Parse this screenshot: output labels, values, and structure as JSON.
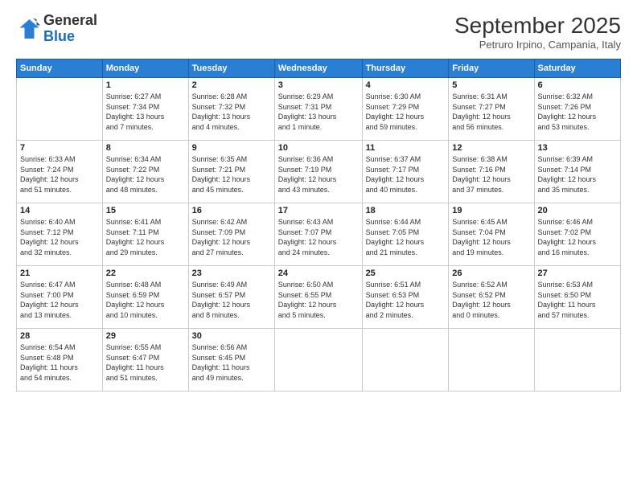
{
  "header": {
    "logo_line1": "General",
    "logo_line2": "Blue",
    "month": "September 2025",
    "location": "Petruro Irpino, Campania, Italy"
  },
  "weekdays": [
    "Sunday",
    "Monday",
    "Tuesday",
    "Wednesday",
    "Thursday",
    "Friday",
    "Saturday"
  ],
  "weeks": [
    [
      {
        "day": "",
        "info": ""
      },
      {
        "day": "1",
        "info": "Sunrise: 6:27 AM\nSunset: 7:34 PM\nDaylight: 13 hours\nand 7 minutes."
      },
      {
        "day": "2",
        "info": "Sunrise: 6:28 AM\nSunset: 7:32 PM\nDaylight: 13 hours\nand 4 minutes."
      },
      {
        "day": "3",
        "info": "Sunrise: 6:29 AM\nSunset: 7:31 PM\nDaylight: 13 hours\nand 1 minute."
      },
      {
        "day": "4",
        "info": "Sunrise: 6:30 AM\nSunset: 7:29 PM\nDaylight: 12 hours\nand 59 minutes."
      },
      {
        "day": "5",
        "info": "Sunrise: 6:31 AM\nSunset: 7:27 PM\nDaylight: 12 hours\nand 56 minutes."
      },
      {
        "day": "6",
        "info": "Sunrise: 6:32 AM\nSunset: 7:26 PM\nDaylight: 12 hours\nand 53 minutes."
      }
    ],
    [
      {
        "day": "7",
        "info": "Sunrise: 6:33 AM\nSunset: 7:24 PM\nDaylight: 12 hours\nand 51 minutes."
      },
      {
        "day": "8",
        "info": "Sunrise: 6:34 AM\nSunset: 7:22 PM\nDaylight: 12 hours\nand 48 minutes."
      },
      {
        "day": "9",
        "info": "Sunrise: 6:35 AM\nSunset: 7:21 PM\nDaylight: 12 hours\nand 45 minutes."
      },
      {
        "day": "10",
        "info": "Sunrise: 6:36 AM\nSunset: 7:19 PM\nDaylight: 12 hours\nand 43 minutes."
      },
      {
        "day": "11",
        "info": "Sunrise: 6:37 AM\nSunset: 7:17 PM\nDaylight: 12 hours\nand 40 minutes."
      },
      {
        "day": "12",
        "info": "Sunrise: 6:38 AM\nSunset: 7:16 PM\nDaylight: 12 hours\nand 37 minutes."
      },
      {
        "day": "13",
        "info": "Sunrise: 6:39 AM\nSunset: 7:14 PM\nDaylight: 12 hours\nand 35 minutes."
      }
    ],
    [
      {
        "day": "14",
        "info": "Sunrise: 6:40 AM\nSunset: 7:12 PM\nDaylight: 12 hours\nand 32 minutes."
      },
      {
        "day": "15",
        "info": "Sunrise: 6:41 AM\nSunset: 7:11 PM\nDaylight: 12 hours\nand 29 minutes."
      },
      {
        "day": "16",
        "info": "Sunrise: 6:42 AM\nSunset: 7:09 PM\nDaylight: 12 hours\nand 27 minutes."
      },
      {
        "day": "17",
        "info": "Sunrise: 6:43 AM\nSunset: 7:07 PM\nDaylight: 12 hours\nand 24 minutes."
      },
      {
        "day": "18",
        "info": "Sunrise: 6:44 AM\nSunset: 7:05 PM\nDaylight: 12 hours\nand 21 minutes."
      },
      {
        "day": "19",
        "info": "Sunrise: 6:45 AM\nSunset: 7:04 PM\nDaylight: 12 hours\nand 19 minutes."
      },
      {
        "day": "20",
        "info": "Sunrise: 6:46 AM\nSunset: 7:02 PM\nDaylight: 12 hours\nand 16 minutes."
      }
    ],
    [
      {
        "day": "21",
        "info": "Sunrise: 6:47 AM\nSunset: 7:00 PM\nDaylight: 12 hours\nand 13 minutes."
      },
      {
        "day": "22",
        "info": "Sunrise: 6:48 AM\nSunset: 6:59 PM\nDaylight: 12 hours\nand 10 minutes."
      },
      {
        "day": "23",
        "info": "Sunrise: 6:49 AM\nSunset: 6:57 PM\nDaylight: 12 hours\nand 8 minutes."
      },
      {
        "day": "24",
        "info": "Sunrise: 6:50 AM\nSunset: 6:55 PM\nDaylight: 12 hours\nand 5 minutes."
      },
      {
        "day": "25",
        "info": "Sunrise: 6:51 AM\nSunset: 6:53 PM\nDaylight: 12 hours\nand 2 minutes."
      },
      {
        "day": "26",
        "info": "Sunrise: 6:52 AM\nSunset: 6:52 PM\nDaylight: 12 hours\nand 0 minutes."
      },
      {
        "day": "27",
        "info": "Sunrise: 6:53 AM\nSunset: 6:50 PM\nDaylight: 11 hours\nand 57 minutes."
      }
    ],
    [
      {
        "day": "28",
        "info": "Sunrise: 6:54 AM\nSunset: 6:48 PM\nDaylight: 11 hours\nand 54 minutes."
      },
      {
        "day": "29",
        "info": "Sunrise: 6:55 AM\nSunset: 6:47 PM\nDaylight: 11 hours\nand 51 minutes."
      },
      {
        "day": "30",
        "info": "Sunrise: 6:56 AM\nSunset: 6:45 PM\nDaylight: 11 hours\nand 49 minutes."
      },
      {
        "day": "",
        "info": ""
      },
      {
        "day": "",
        "info": ""
      },
      {
        "day": "",
        "info": ""
      },
      {
        "day": "",
        "info": ""
      }
    ]
  ]
}
